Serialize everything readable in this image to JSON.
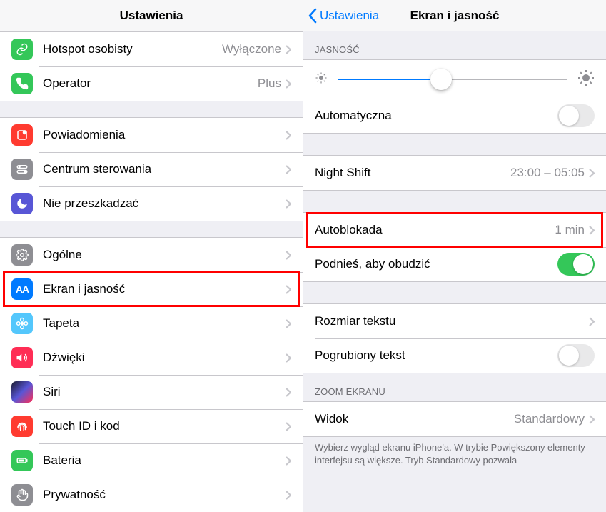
{
  "left": {
    "title": "Ustawienia",
    "groups": [
      [
        {
          "id": "hotspot",
          "label": "Hotspot osobisty",
          "value": "Wyłączone",
          "icon": "ic-hotspot",
          "glyph": "link"
        },
        {
          "id": "carrier",
          "label": "Operator",
          "value": "Plus",
          "icon": "ic-carrier",
          "glyph": "phone"
        }
      ],
      [
        {
          "id": "notif",
          "label": "Powiadomienia",
          "icon": "ic-notif",
          "glyph": "notif"
        },
        {
          "id": "control",
          "label": "Centrum sterowania",
          "icon": "ic-control",
          "glyph": "switches"
        },
        {
          "id": "dnd",
          "label": "Nie przeszkadzać",
          "icon": "ic-dnd",
          "glyph": "moon"
        }
      ],
      [
        {
          "id": "general",
          "label": "Ogólne",
          "icon": "ic-general",
          "glyph": "gear"
        },
        {
          "id": "display",
          "label": "Ekran i jasność",
          "icon": "ic-display",
          "glyph": "aa",
          "highlight": true
        },
        {
          "id": "wallpaper",
          "label": "Tapeta",
          "icon": "ic-wallpaper",
          "glyph": "flower"
        },
        {
          "id": "sounds",
          "label": "Dźwięki",
          "icon": "ic-sounds",
          "glyph": "speaker"
        },
        {
          "id": "siri",
          "label": "Siri",
          "icon": "ic-siri",
          "glyph": ""
        },
        {
          "id": "touchid",
          "label": "Touch ID i kod",
          "icon": "ic-touchid",
          "glyph": "fingerprint"
        },
        {
          "id": "battery",
          "label": "Bateria",
          "icon": "ic-battery",
          "glyph": "battery"
        },
        {
          "id": "privacy",
          "label": "Prywatność",
          "icon": "ic-privacy",
          "glyph": "hand"
        }
      ]
    ]
  },
  "right": {
    "back": "Ustawienia",
    "title": "Ekran i jasność",
    "brightness_header": "JASNOŚĆ",
    "brightness_value": 45,
    "auto_brightness_label": "Automatyczna",
    "auto_brightness_on": false,
    "night_shift_label": "Night Shift",
    "night_shift_value": "23:00 – 05:05",
    "auto_lock_label": "Autoblokada",
    "auto_lock_value": "1 min",
    "raise_label": "Podnieś, aby obudzić",
    "raise_on": true,
    "text_size_label": "Rozmiar tekstu",
    "bold_label": "Pogrubiony tekst",
    "bold_on": false,
    "zoom_header": "ZOOM EKRANU",
    "zoom_view_label": "Widok",
    "zoom_view_value": "Standardowy",
    "zoom_footer": "Wybierz wygląd ekranu iPhone'a. W trybie Powiększony elementy interfejsu są większe. Tryb Standardowy pozwala"
  }
}
